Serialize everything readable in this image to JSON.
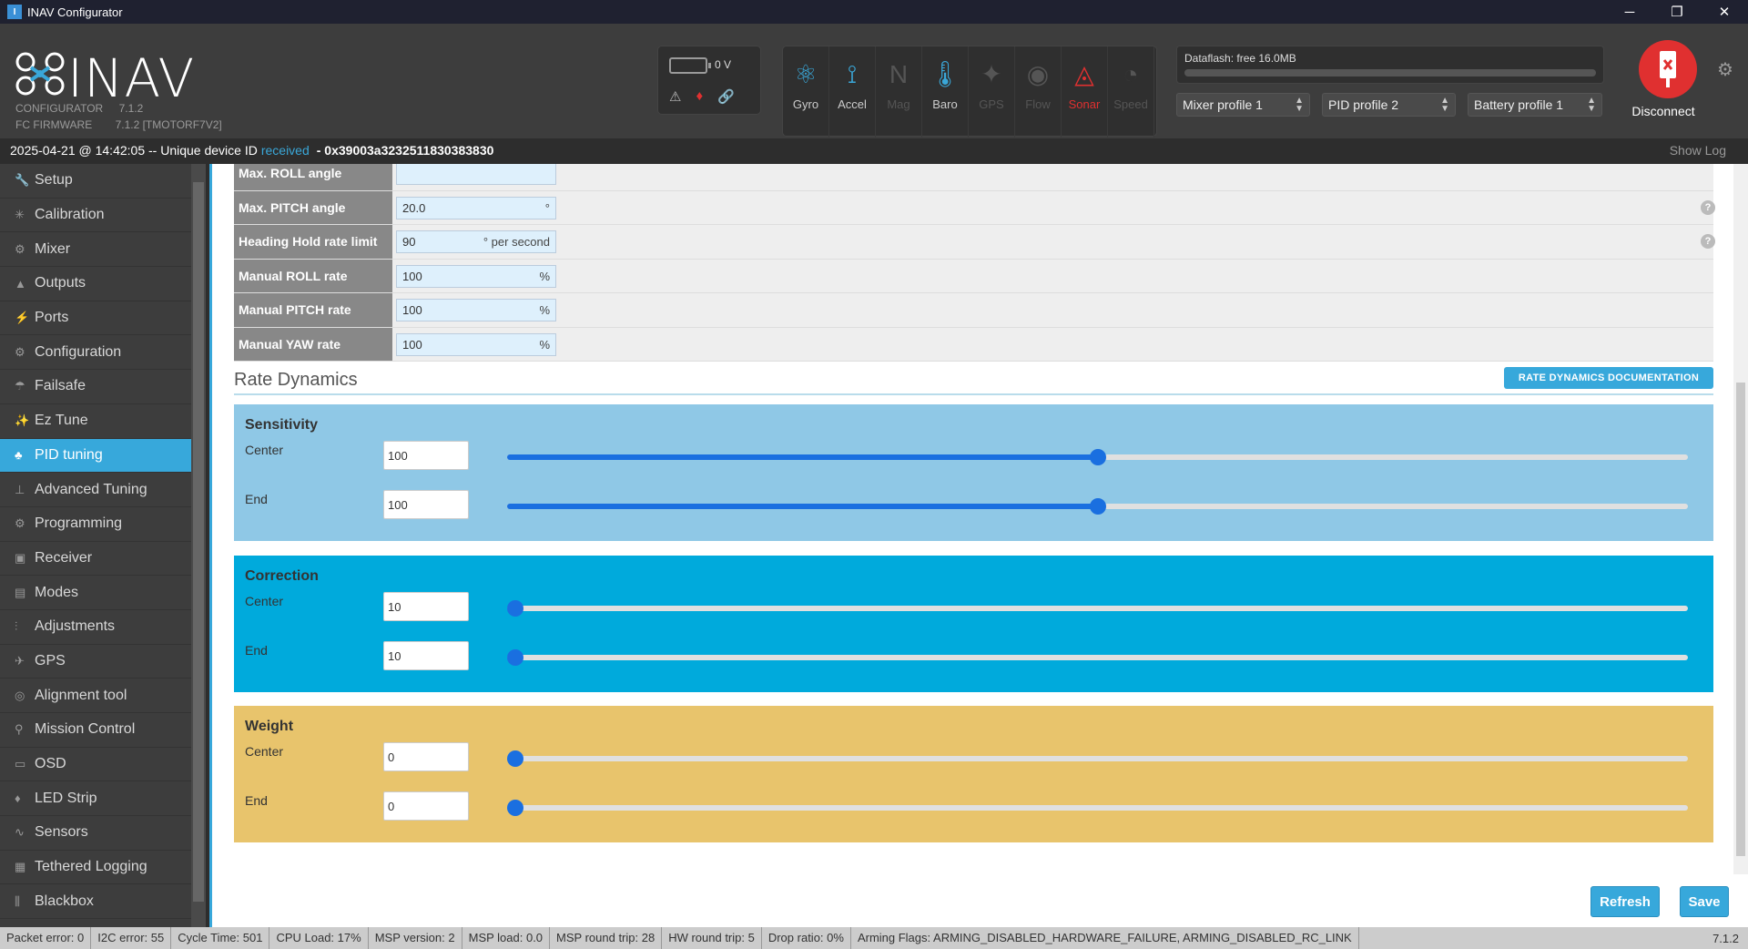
{
  "window": {
    "title": "INAV Configurator",
    "min": "─",
    "max": "❐",
    "close": "✕"
  },
  "header": {
    "logo_text": "INAV",
    "configurator_label": "CONFIGURATOR",
    "configurator_version": "7.1.2",
    "firmware_label": "FC FIRMWARE",
    "firmware_version": "7.1.2 [TMOTORF7V2]",
    "battery_voltage": "0 V",
    "sensors": [
      {
        "label": "Gyro",
        "state": "on",
        "icon": "gyro-icon"
      },
      {
        "label": "Accel",
        "state": "on",
        "icon": "accel-icon"
      },
      {
        "label": "Mag",
        "state": "off",
        "icon": "mag-icon"
      },
      {
        "label": "Baro",
        "state": "on",
        "icon": "baro-icon"
      },
      {
        "label": "GPS",
        "state": "off",
        "icon": "gps-icon"
      },
      {
        "label": "Flow",
        "state": "off",
        "icon": "flow-icon"
      },
      {
        "label": "Sonar",
        "state": "alert",
        "icon": "sonar-icon"
      },
      {
        "label": "Speed",
        "state": "off",
        "icon": "speed-icon"
      }
    ],
    "dataflash": "Dataflash: free 16.0MB",
    "mixer_profile": "Mixer profile 1",
    "pid_profile": "PID profile 2",
    "battery_profile": "Battery profile 1",
    "disconnect": "Disconnect"
  },
  "infobar": {
    "timestamp": "2025-04-21 @ 14:42:05 -- Unique device ID",
    "received": "received",
    "device_id": "- 0x39003a3232511830383830",
    "show_log": "Show Log"
  },
  "sidebar": [
    {
      "label": "Setup",
      "icon": "wrench-icon",
      "glyph": "🔧"
    },
    {
      "label": "Calibration",
      "icon": "calibration-icon",
      "glyph": "✳"
    },
    {
      "label": "Mixer",
      "icon": "mixer-icon",
      "glyph": "⚙"
    },
    {
      "label": "Outputs",
      "icon": "outputs-icon",
      "glyph": "▲"
    },
    {
      "label": "Ports",
      "icon": "ports-icon",
      "glyph": "⚡"
    },
    {
      "label": "Configuration",
      "icon": "gear-icon",
      "glyph": "⚙"
    },
    {
      "label": "Failsafe",
      "icon": "parachute-icon",
      "glyph": "☂"
    },
    {
      "label": "Ez Tune",
      "icon": "magic-wand-icon",
      "glyph": "✨"
    },
    {
      "label": "PID tuning",
      "icon": "sitemap-icon",
      "glyph": "♣",
      "active": true
    },
    {
      "label": "Advanced Tuning",
      "icon": "advanced-tuning-icon",
      "glyph": "⊥"
    },
    {
      "label": "Programming",
      "icon": "cog-icon",
      "glyph": "⚙"
    },
    {
      "label": "Receiver",
      "icon": "receiver-icon",
      "glyph": "▣"
    },
    {
      "label": "Modes",
      "icon": "modes-icon",
      "glyph": "▤"
    },
    {
      "label": "Adjustments",
      "icon": "sliders-icon",
      "glyph": "⫶"
    },
    {
      "label": "GPS",
      "icon": "satellite-icon",
      "glyph": "✈"
    },
    {
      "label": "Alignment tool",
      "icon": "compass-icon",
      "glyph": "◎"
    },
    {
      "label": "Mission Control",
      "icon": "map-marker-icon",
      "glyph": "⚲"
    },
    {
      "label": "OSD",
      "icon": "osd-icon",
      "glyph": "▭"
    },
    {
      "label": "LED Strip",
      "icon": "led-icon",
      "glyph": "♦"
    },
    {
      "label": "Sensors",
      "icon": "sensors-icon",
      "glyph": "∿"
    },
    {
      "label": "Tethered Logging",
      "icon": "log-icon",
      "glyph": "▦"
    },
    {
      "label": "Blackbox",
      "icon": "blackbox-icon",
      "glyph": "⫼"
    }
  ],
  "rate_rows": [
    {
      "label": "Max. ROLL angle",
      "value": "",
      "unit": ""
    },
    {
      "label": "Max. PITCH angle",
      "value": "20.0",
      "unit": "°",
      "help": true
    },
    {
      "label": "Heading Hold rate limit",
      "value": "90",
      "unit": "° per second",
      "help": true
    },
    {
      "label": "Manual ROLL rate",
      "value": "100",
      "unit": "%"
    },
    {
      "label": "Manual PITCH rate",
      "value": "100",
      "unit": "%"
    },
    {
      "label": "Manual YAW rate",
      "value": "100",
      "unit": "%"
    }
  ],
  "rate_dynamics": {
    "title": "Rate Dynamics",
    "doc_button": "RATE DYNAMICS DOCUMENTATION",
    "panels": [
      {
        "title": "Sensitivity",
        "color": "#8fc8e6",
        "rows": [
          {
            "label": "Center",
            "value": "100",
            "level": 0.5
          },
          {
            "label": "End",
            "value": "100",
            "level": 0.5
          }
        ]
      },
      {
        "title": "Correction",
        "color": "#00aadc",
        "rows": [
          {
            "label": "Center",
            "value": "10",
            "level": 0.0
          },
          {
            "label": "End",
            "value": "10",
            "level": 0.0
          }
        ]
      },
      {
        "title": "Weight",
        "color": "#e8c46c",
        "rows": [
          {
            "label": "Center",
            "value": "0",
            "level": 0.0
          },
          {
            "label": "End",
            "value": "0",
            "level": 0.0
          }
        ]
      }
    ]
  },
  "buttons": {
    "refresh": "Refresh",
    "save": "Save"
  },
  "statusbar": {
    "items": [
      "Packet error: 0",
      "I2C error: 55",
      "Cycle Time: 501",
      "CPU Load: 17%",
      "MSP version: 2",
      "MSP load: 0.0",
      "MSP round trip: 28",
      "HW round trip: 5",
      "Drop ratio: 0%",
      "Arming Flags: ARMING_DISABLED_HARDWARE_FAILURE, ARMING_DISABLED_RC_LINK"
    ],
    "version": "7.1.2"
  }
}
